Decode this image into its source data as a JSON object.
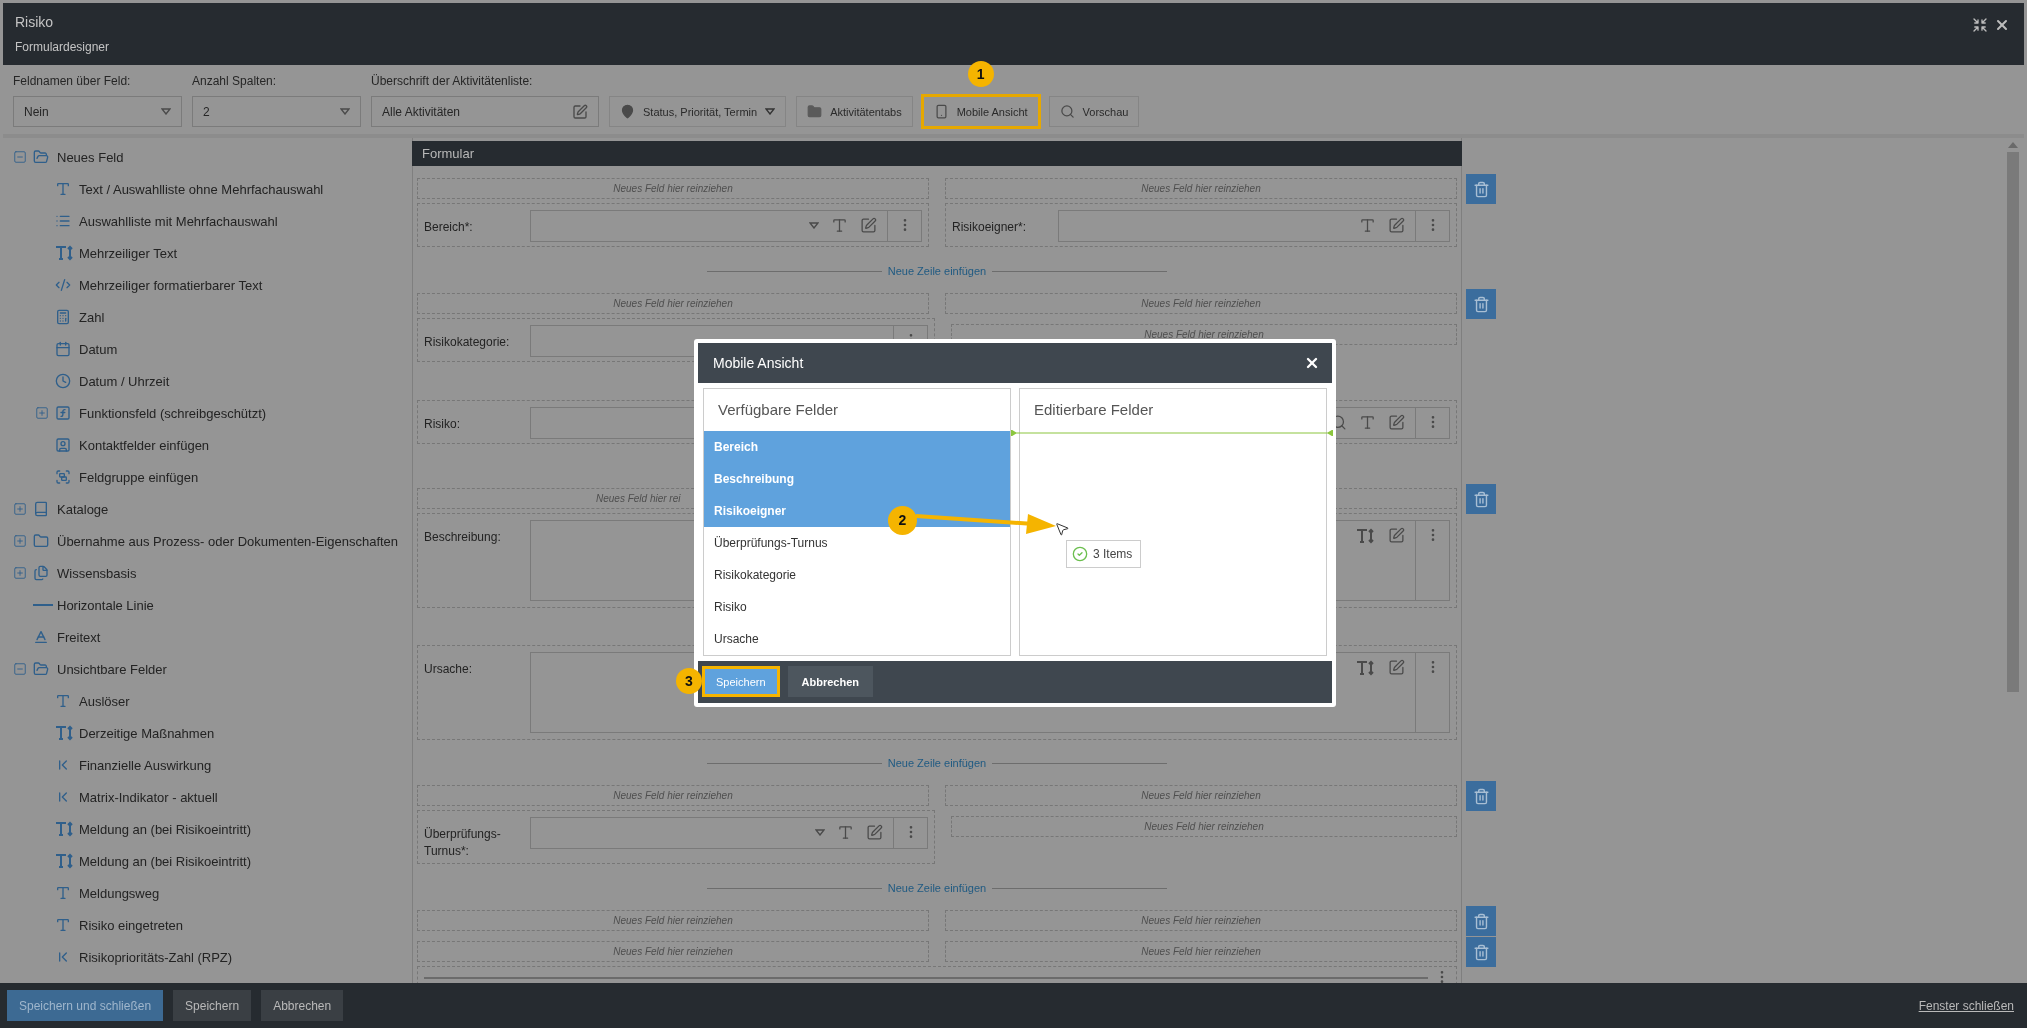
{
  "window": {
    "title": "Risiko",
    "subtitle": "Formulardesigner"
  },
  "toolbar": {
    "fields": [
      {
        "label": "Feldnamen über Feld:",
        "value": "Nein",
        "kind": "select"
      },
      {
        "label": "Anzahl Spalten:",
        "value": "2",
        "kind": "select"
      },
      {
        "label": "Überschrift der Aktivitätenliste:",
        "value": "Alle Aktivitäten",
        "kind": "input"
      }
    ],
    "buttons": [
      {
        "label": "Status, Priorität, Termin",
        "kind": "pin",
        "dropdown": true
      },
      {
        "label": "Aktivitätentabs",
        "kind": "folder",
        "dropdown": false
      },
      {
        "label": "Mobile Ansicht",
        "kind": "phone",
        "dropdown": false,
        "callout": "1"
      },
      {
        "label": "Vorschau",
        "kind": "search",
        "dropdown": false
      }
    ]
  },
  "sidebar": {
    "items": [
      {
        "label": "Neues Feld",
        "kind": "folder",
        "expanded": true,
        "children": [
          {
            "label": "Text / Auswahlliste ohne Mehrfachauswahl",
            "kind": "text"
          },
          {
            "label": "Auswahlliste mit Mehrfachauswahl",
            "kind": "list"
          },
          {
            "label": "Mehrzeiliger Text",
            "kind": "multiline"
          },
          {
            "label": "Mehrzeiliger formatierbarer Text",
            "kind": "code"
          },
          {
            "label": "Zahl",
            "kind": "number"
          },
          {
            "label": "Datum",
            "kind": "date"
          },
          {
            "label": "Datum / Uhrzeit",
            "kind": "time"
          },
          {
            "label": "Funktionsfeld (schreibgeschützt)",
            "kind": "function",
            "expanded": false
          },
          {
            "label": "Kontaktfelder einfügen",
            "kind": "contact"
          },
          {
            "label": "Feldgruppe einfügen",
            "kind": "group"
          }
        ]
      },
      {
        "label": "Kataloge",
        "kind": "catalog",
        "expanded": false
      },
      {
        "label": "Übernahme aus Prozess- oder Dokumenten-Eigenschaften",
        "kind": "folder",
        "expanded": false
      },
      {
        "label": "Wissensbasis",
        "kind": "docs",
        "expanded": false
      },
      {
        "label": "Horizontale Linie",
        "kind": "line"
      },
      {
        "label": "Freitext",
        "kind": "freetext"
      },
      {
        "label": "Unsichtbare Felder",
        "kind": "folder",
        "expanded": true,
        "children": [
          {
            "label": "Auslöser",
            "kind": "text"
          },
          {
            "label": "Derzeitige Maßnahmen",
            "kind": "multiline"
          },
          {
            "label": "Finanzielle Auswirkung",
            "kind": "lookup"
          },
          {
            "label": "Matrix-Indikator - aktuell",
            "kind": "lookup"
          },
          {
            "label": "Meldung an (bei Risikoeintritt)",
            "kind": "multiline"
          },
          {
            "label": "Meldung an (bei Risikoeintritt)",
            "kind": "multiline"
          },
          {
            "label": "Meldungsweg",
            "kind": "text"
          },
          {
            "label": "Risiko eingetreten",
            "kind": "text"
          },
          {
            "label": "Risikoprioritäts-Zahl (RPZ)",
            "kind": "lookup"
          }
        ]
      }
    ]
  },
  "form": {
    "title": "Formular",
    "rows": [
      {
        "kind": "drops",
        "left": "Neues Feld hier reinziehen",
        "right": "Neues Feld hier reinziehen",
        "deletable": true
      },
      {
        "kind": "fields",
        "left": {
          "kind": "text",
          "label": "Bereich*:",
          "dropdown": true
        },
        "right": {
          "kind": "text",
          "label": "Risikoeigner*:",
          "dropdown": false
        }
      },
      {
        "kind": "insert",
        "text": "Neue Zeile einfügen"
      },
      {
        "kind": "drops",
        "left": "Neues Feld hier reinziehen",
        "right": "Neues Feld hier reinziehen",
        "deletable": true
      },
      {
        "kind": "fields",
        "left": {
          "kind": "plain",
          "label": "Risikokategorie:"
        },
        "right": {
          "kind": "drop",
          "text": "Neues Feld hier reinziehen"
        }
      },
      {
        "kind": "gap"
      },
      {
        "kind": "fields",
        "left": {
          "kind": "text",
          "label": "Risiko:"
        },
        "right": {
          "kind": "lookup"
        }
      },
      {
        "kind": "gap"
      },
      {
        "kind": "drops",
        "left": "Neues Feld hier rei",
        "deletable": true
      },
      {
        "kind": "wide",
        "label": "Beschreibung:"
      },
      {
        "kind": "gap"
      },
      {
        "kind": "wide",
        "label": "Ursache:"
      },
      {
        "kind": "insert",
        "text": "Neue Zeile einfügen"
      },
      {
        "kind": "drops",
        "left": "Neues Feld hier reinziehen",
        "right": "Neues Feld hier reinziehen",
        "deletable": true
      },
      {
        "kind": "fields",
        "left": {
          "kind": "text",
          "label": "Überprüfungs-Turnus*:",
          "dropdown": true
        },
        "right": {
          "kind": "drop",
          "text": "Neues Feld hier reinziehen"
        }
      },
      {
        "kind": "insert",
        "text": "Neue Zeile einfügen"
      },
      {
        "kind": "drops",
        "left": "Neues Feld hier reinziehen",
        "right": "Neues Feld hier reinziehen",
        "deletable": true
      },
      {
        "kind": "drops",
        "left": "Neues Feld hier reinziehen",
        "right": "Neues Feld hier reinziehen",
        "deletable": true
      },
      {
        "kind": "line"
      }
    ]
  },
  "footer": {
    "buttons": [
      {
        "label": "Speichern und schließen",
        "primary": true
      },
      {
        "label": "Speichern",
        "primary": false
      },
      {
        "label": "Abbrechen",
        "primary": false
      }
    ],
    "link": "Fenster schließen"
  },
  "dialog": {
    "title": "Mobile Ansicht",
    "lists": [
      {
        "title": "Verfügbare Felder",
        "items": [
          {
            "label": "Bereich",
            "selected": true
          },
          {
            "label": "Beschreibung",
            "selected": true
          },
          {
            "label": "Risikoeigner",
            "selected": true
          },
          {
            "label": "Überprüfungs-Turnus",
            "selected": false
          },
          {
            "label": "Risikokategorie",
            "selected": false
          },
          {
            "label": "Risiko",
            "selected": false
          },
          {
            "label": "Ursache",
            "selected": false
          }
        ]
      },
      {
        "title": "Editierbare Felder",
        "drop_target": true
      }
    ],
    "drag": {
      "label": "3 Items",
      "callout": "2"
    },
    "buttons": [
      {
        "label": "Speichern",
        "primary": true,
        "callout": "3"
      },
      {
        "label": "Abbrechen",
        "primary": false
      }
    ]
  }
}
